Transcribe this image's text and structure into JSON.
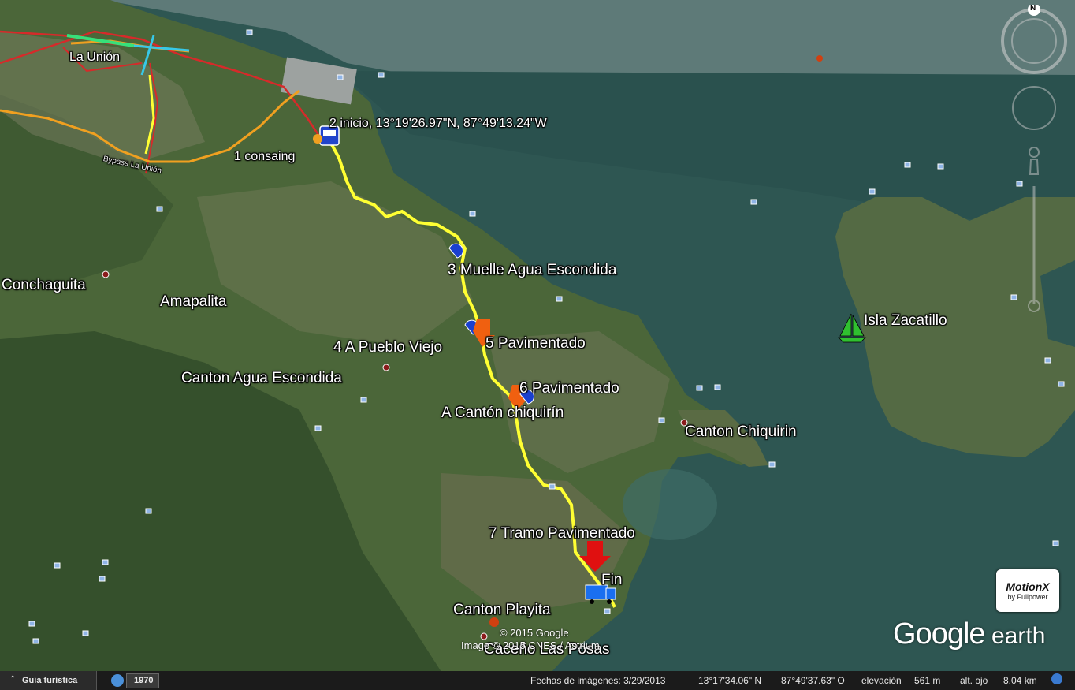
{
  "places": {
    "la_union": "La Unión",
    "conchaguita": "Conchaguita",
    "amapalita": "Amapalita",
    "canton_agua_escondida": "Canton Agua Escondida",
    "canton_chiquirin": "Canton Chiquirin",
    "isla_zacatillo": "Isla Zacatillo",
    "canton_playita": "Canton Playita",
    "caceno_las_posas": "Caceño Las Posas",
    "road": "Bypass La Unión"
  },
  "route": {
    "p1": "1 consaing",
    "p2": "2  inicio, 13°19'26.97\"N,  87°49'13.24\"W",
    "p3": "3  Muelle Agua Escondida",
    "p4": "4 A Pueblo Viejo",
    "p5": "5 Pavimentado",
    "p6": "6  Pavimentado",
    "p6b": "A Cantón chiquirín",
    "p7": "7  Tramo Pavimentado",
    "fin": "Fin"
  },
  "copyright": {
    "line1": "© 2015 Google",
    "line2": "Image © 2015 CNES / Astrium"
  },
  "branding": {
    "google": "Google",
    "earth": "earth",
    "motionx": "MotionX",
    "fullpower": "by Fullpower",
    "compass_n": "N"
  },
  "statusbar": {
    "tour": "Guía turística",
    "year": "1970",
    "imagery_date": "Fechas de imágenes: 3/29/2013",
    "lat": "13°17'34.06\" N",
    "lon": "87°49'37.63\" O",
    "elev_label": "elevación",
    "elev": "561 m",
    "eye_label": "alt. ojo",
    "eye": "8.04 km"
  },
  "colors": {
    "route": "#ffff33",
    "water": "#2d5b57",
    "land": "#4f6a3c"
  }
}
